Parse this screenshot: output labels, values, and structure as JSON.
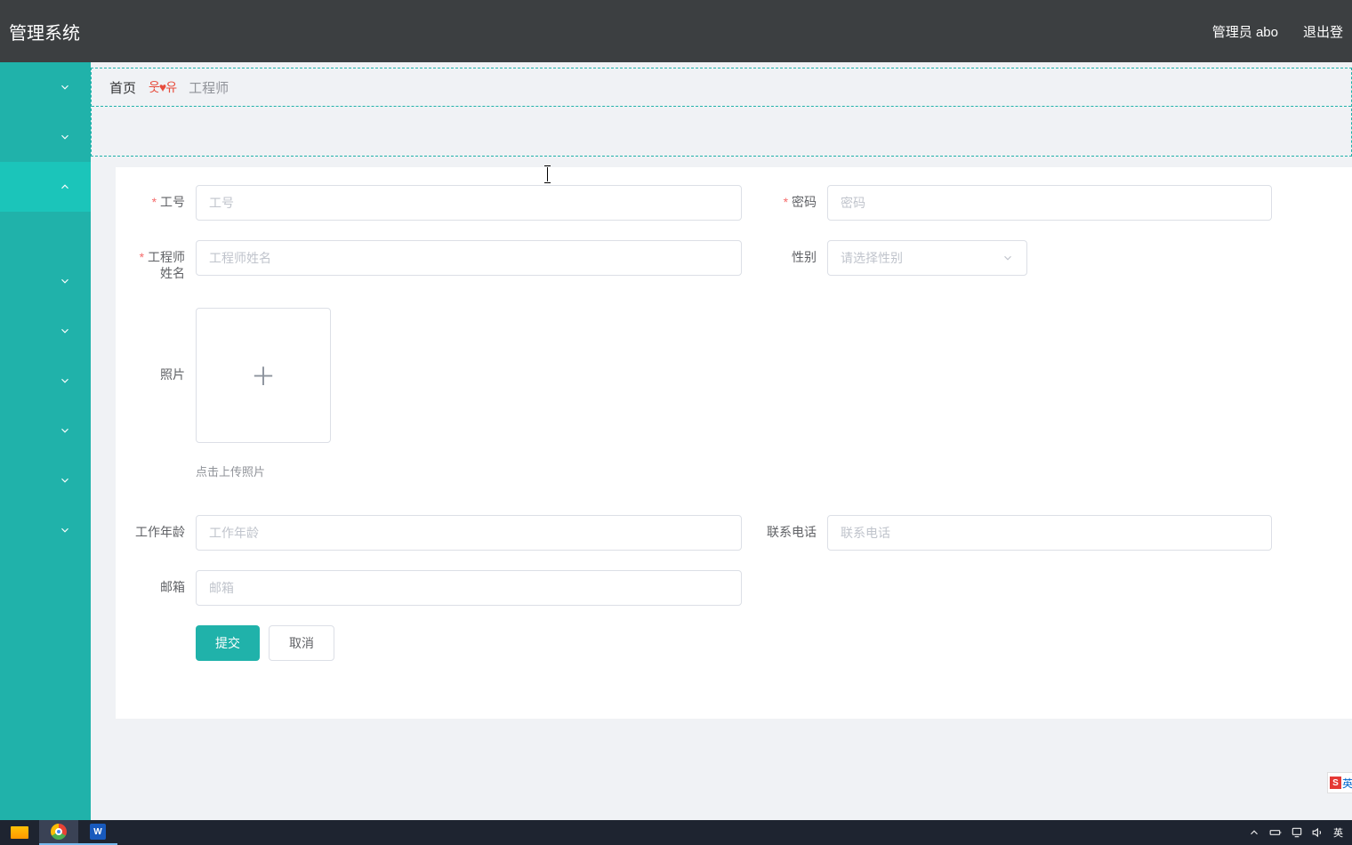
{
  "header": {
    "title": "管理系统",
    "admin": "管理员 abo",
    "logout": "退出登"
  },
  "tabs": {
    "home": "首页",
    "face": "웃♥유",
    "engineer": "工程师"
  },
  "form": {
    "employee_id": {
      "label": "工号",
      "placeholder": "工号"
    },
    "password": {
      "label": "密码",
      "placeholder": "密码"
    },
    "engineer_name": {
      "label": "工程师姓名",
      "placeholder": "工程师姓名"
    },
    "gender": {
      "label": "性别",
      "placeholder": "请选择性别"
    },
    "photo": {
      "label": "照片",
      "hint": "点击上传照片"
    },
    "work_age": {
      "label": "工作年龄",
      "placeholder": "工作年龄"
    },
    "phone": {
      "label": "联系电话",
      "placeholder": "联系电话"
    },
    "email": {
      "label": "邮箱",
      "placeholder": "邮箱"
    },
    "submit": "提交",
    "cancel": "取消"
  },
  "ime": {
    "s": "S",
    "text": "英"
  },
  "taskbar": {
    "word": "W",
    "lang": "英"
  }
}
